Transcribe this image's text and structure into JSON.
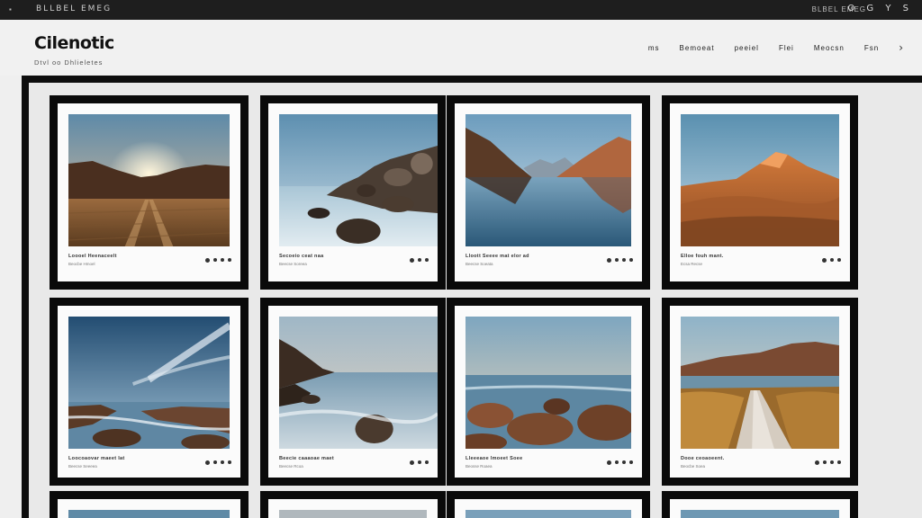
{
  "topbar": {
    "brand": "BLLBEL EMEG",
    "right_text": "BLBEL EMEG",
    "right_icons": "O G Y S"
  },
  "header": {
    "logo": "Cilenotic",
    "tagline": "Dtvl oo Dhlieletes",
    "nav": [
      "ms",
      "Bemoeat",
      "peeiel",
      "Flei",
      "Meocsn",
      "Fsn"
    ],
    "nav_more": "›"
  },
  "gallery": {
    "cards": [
      {
        "title": "Loooel Heenaceelt",
        "subtitle": "Beocbe  Hmoel",
        "photo": "desert-sunset-road"
      },
      {
        "title": "Secoeio ceat naa",
        "subtitle": "Beecse  Soreea",
        "photo": "rocky-shore-long-exposure"
      },
      {
        "title": "Lloott Seeee mat elor ad",
        "subtitle": "Beecse  Soeata",
        "photo": "mountain-lake-reflection"
      },
      {
        "title": "Elloe  fouh  mant.",
        "subtitle": "Ecsa  Recse",
        "photo": "orange-sand-dunes"
      },
      {
        "title": "Loocoaovar maeet lat",
        "subtitle": "Beecse  Seeeea",
        "photo": "coastal-rocks-clouds"
      },
      {
        "title": "Beecie  caaaoae  maet",
        "subtitle": "Beecse  Rcoa",
        "photo": "cliff-sea-boulder"
      },
      {
        "title": "Lleeeaoe  lmoeet  Soee",
        "subtitle": "Beosse  Roaea",
        "photo": "sea-boulders-horizon"
      },
      {
        "title": "Dooe  ceoaoeent.",
        "subtitle": "Beocbe  Soea",
        "photo": "boardwalk-grassland"
      }
    ]
  },
  "colors": {
    "frame": "#0a0a0a",
    "mat": "#fbfbfb",
    "background": "#efefef",
    "topbar": "#1e1e1e"
  }
}
